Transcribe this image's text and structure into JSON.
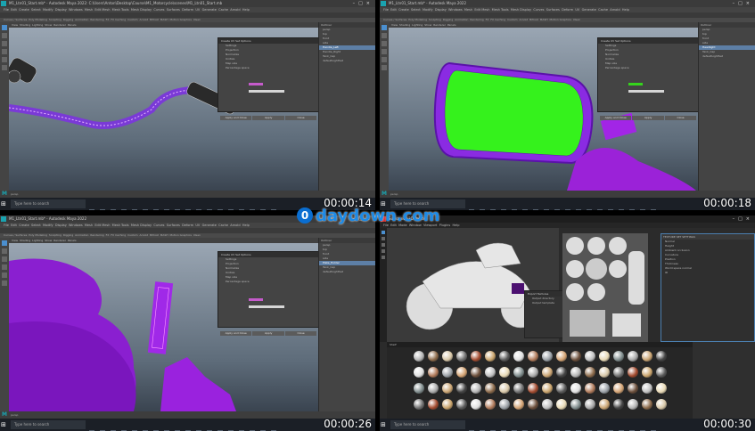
{
  "watermark": {
    "text": "daydown.com",
    "logo_glyph": "0"
  },
  "frames": [
    {
      "id": "top-left",
      "title": "M1_Ltn01_Start.mb* - Autodesk Maya 2022: C:\\Users\\Anton\\Desktop\\Course\\M1_Motorcycle\\scenes\\M1_Ltn01_Start.mb",
      "menus": [
        "File",
        "Edit",
        "Create",
        "Select",
        "Modify",
        "Display",
        "Windows",
        "Mesh",
        "Edit Mesh",
        "Mesh Tools",
        "Mesh Display",
        "Curves",
        "Surfaces",
        "Deform",
        "UV",
        "Generate",
        "Cache",
        "Arnold",
        "Help"
      ],
      "shelf_tabs": [
        "Curves / Surfaces",
        "Poly Modeling",
        "Sculpting",
        "Rigging",
        "Animation",
        "Rendering",
        "FX",
        "FX Caching",
        "Custom",
        "Arnold",
        "Bifrost",
        "MASH",
        "Motion Graphics",
        "XGen"
      ],
      "viewport_menu": [
        "View",
        "Shading",
        "Lighting",
        "Show",
        "Renderer",
        "Panels"
      ],
      "outliner_header": "Outliner",
      "outliner_items": [
        "persp",
        "top",
        "front",
        "side",
        "Handle_Left",
        "Handle_Right",
        "Tank_Cap",
        "defaultLightSet"
      ],
      "panel_title": "Create UV Set Options",
      "panel_rows": [
        "Settings",
        "Projection",
        "Normalize",
        "Unitize",
        "Map size",
        "Percentage space"
      ],
      "panel_buttons": [
        "Apply and Close",
        "Apply",
        "Close"
      ],
      "status_text": "persp",
      "timestamp": "00:00:14",
      "taskbar_search": "Type here to search"
    },
    {
      "id": "top-right",
      "title": "M1_Ltn01_Start.mb* - Autodesk Maya 2022",
      "menus": [
        "File",
        "Edit",
        "Create",
        "Select",
        "Modify",
        "Display",
        "Windows",
        "Mesh",
        "Edit Mesh",
        "Mesh Tools",
        "Mesh Display",
        "Curves",
        "Surfaces",
        "Deform",
        "UV",
        "Generate",
        "Cache",
        "Arnold",
        "Help"
      ],
      "shelf_tabs": [
        "Curves / Surfaces",
        "Poly Modeling",
        "Sculpting",
        "Rigging",
        "Animation",
        "Rendering",
        "FX",
        "FX Caching",
        "Custom",
        "Arnold",
        "Bifrost",
        "MASH",
        "Motion Graphics",
        "XGen"
      ],
      "viewport_menu": [
        "View",
        "Shading",
        "Lighting",
        "Show",
        "Renderer",
        "Panels"
      ],
      "outliner_header": "Outliner",
      "outliner_items": [
        "persp",
        "top",
        "front",
        "side",
        "Headlight",
        "Tank_Cap",
        "defaultLightSet"
      ],
      "panel_title": "Create UV Set Options",
      "panel_rows": [
        "Settings",
        "Projection",
        "Normalize",
        "Unitize",
        "Map size",
        "Percentage space"
      ],
      "panel_buttons": [
        "Apply and Close",
        "Apply",
        "Close"
      ],
      "status_text": "persp",
      "timestamp": "00:00:18",
      "taskbar_search": "Type here to search"
    },
    {
      "id": "bottom-left",
      "title": "M1_Ltn01_Start.mb* - Autodesk Maya 2022",
      "menus": [
        "File",
        "Edit",
        "Create",
        "Select",
        "Modify",
        "Display",
        "Windows",
        "Mesh",
        "Edit Mesh",
        "Mesh Tools",
        "Mesh Display",
        "Curves",
        "Surfaces",
        "Deform",
        "UV",
        "Generate",
        "Cache",
        "Arnold",
        "Help"
      ],
      "shelf_tabs": [
        "Curves / Surfaces",
        "Poly Modeling",
        "Sculpting",
        "Rigging",
        "Animation",
        "Rendering",
        "FX",
        "FX Caching",
        "Custom",
        "Arnold",
        "Bifrost",
        "MASH",
        "Motion Graphics",
        "XGen"
      ],
      "viewport_menu": [
        "View",
        "Shading",
        "Lighting",
        "Show",
        "Renderer",
        "Panels"
      ],
      "outliner_header": "Outliner",
      "outliner_items": [
        "persp",
        "top",
        "front",
        "side",
        "Plate_Holder",
        "Tank_Cap",
        "defaultLightSet"
      ],
      "panel_title": "Create UV Set Options",
      "panel_rows": [
        "Settings",
        "Projection",
        "Normalize",
        "Unitize",
        "Map size",
        "Percentage space"
      ],
      "panel_buttons": [
        "Apply and Close",
        "Apply",
        "Close"
      ],
      "status_text": "persp",
      "timestamp": "00:00:26",
      "taskbar_search": "Type here to search"
    },
    {
      "id": "bottom-right",
      "title": "Substance 3D Painter",
      "menus": [
        "File",
        "Edit",
        "Mode",
        "Window",
        "Viewport",
        "Plugins",
        "Help"
      ],
      "shelf_tabs": [],
      "viewport_menu": [
        "Material",
        "Base Color"
      ],
      "outliner_header": "TEXTURE SET SETTINGS",
      "outliner_items": [
        "Normal",
        "Height",
        "Ambient occlusion",
        "Curvature",
        "Position",
        "Thickness",
        "World space normal",
        "ID"
      ],
      "panel_title": "Export Textures",
      "panel_rows": [
        "Output directory",
        "Output template",
        "File type",
        "Size",
        "Padding"
      ],
      "panel_buttons": [
        "Export",
        "Cancel"
      ],
      "status_text": "Shelf",
      "timestamp": "00:00:30",
      "taskbar_search": "Type here to search"
    }
  ]
}
